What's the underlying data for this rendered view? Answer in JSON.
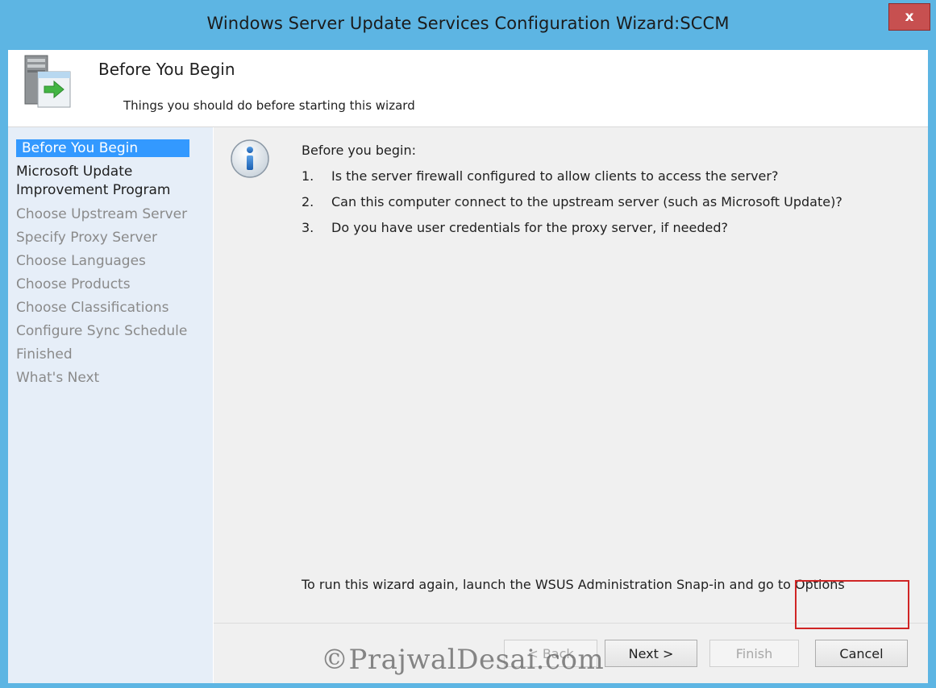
{
  "window": {
    "title": "Windows Server Update Services Configuration Wizard:SCCM",
    "close_label": "x"
  },
  "header": {
    "title": "Before You Begin",
    "subtitle": "Things you should do before starting this wizard",
    "icon": "server-update-icon"
  },
  "sidebar": {
    "steps": [
      {
        "label": "Before You Begin",
        "state": "active"
      },
      {
        "label": "Microsoft Update\nImprovement Program",
        "label_line1": "Microsoft Update",
        "label_line2": "Improvement Program",
        "state": "done"
      },
      {
        "label": "Choose Upstream Server",
        "state": "pending"
      },
      {
        "label": "Specify Proxy Server",
        "state": "pending"
      },
      {
        "label": "Choose Languages",
        "state": "pending"
      },
      {
        "label": "Choose Products",
        "state": "pending"
      },
      {
        "label": "Choose Classifications",
        "state": "pending"
      },
      {
        "label": "Configure Sync Schedule",
        "state": "pending"
      },
      {
        "label": "Finished",
        "state": "pending"
      },
      {
        "label": "What's Next",
        "state": "pending"
      }
    ]
  },
  "main": {
    "info_icon": "info-icon",
    "intro": "Before you begin:",
    "items": [
      {
        "num": "1.",
        "text": "Is the server firewall configured to allow clients to access the server?"
      },
      {
        "num": "2.",
        "text": "Can this computer connect to the upstream server (such as Microsoft Update)?"
      },
      {
        "num": "3.",
        "text": "Do you have user credentials for the proxy server, if needed?"
      }
    ],
    "footer_note": "To run this wizard again, launch the WSUS Administration Snap-in and go to Options"
  },
  "buttons": {
    "back": "< Back",
    "next": "Next >",
    "finish": "Finish",
    "cancel": "Cancel"
  },
  "watermark": "©PrajwalDesai.com",
  "colors": {
    "frame": "#5db5e3",
    "active_step": "#3399ff",
    "sidebar_bg": "#e6eef8",
    "highlight": "#d02525"
  }
}
